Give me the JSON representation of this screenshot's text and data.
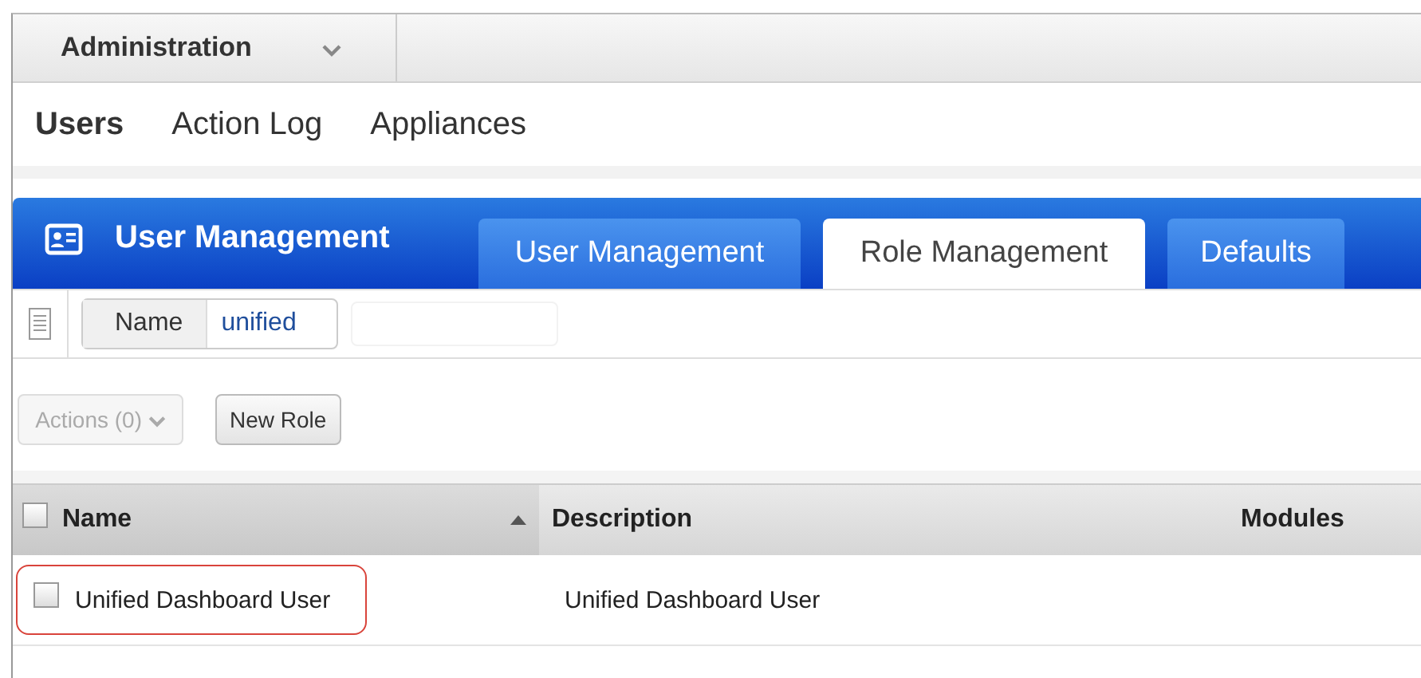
{
  "menu": {
    "label": "Administration"
  },
  "nav": [
    {
      "label": "Users",
      "selected": true
    },
    {
      "label": "Action Log",
      "selected": false
    },
    {
      "label": "Appliances",
      "selected": false
    }
  ],
  "header": {
    "title": "User Management"
  },
  "tabs": [
    {
      "label": "User Management",
      "selected": false
    },
    {
      "label": "Role Management",
      "selected": true
    },
    {
      "label": "Defaults",
      "selected": false
    }
  ],
  "filter": {
    "field": "Name",
    "value": "unified"
  },
  "toolbar": {
    "actions": {
      "label": "Actions (0)",
      "disabled": true
    },
    "new_button": "New Role"
  },
  "table": {
    "select_all_checked": false,
    "columns": [
      {
        "label": "Name",
        "sorted": true
      },
      {
        "label": "Description",
        "sorted": false
      },
      {
        "label": "Modules",
        "sorted": false
      }
    ],
    "rows": [
      {
        "cells": [
          "Unified Dashboard User",
          "Unified Dashboard User"
        ],
        "checked": false,
        "highlighted": true
      }
    ]
  }
}
